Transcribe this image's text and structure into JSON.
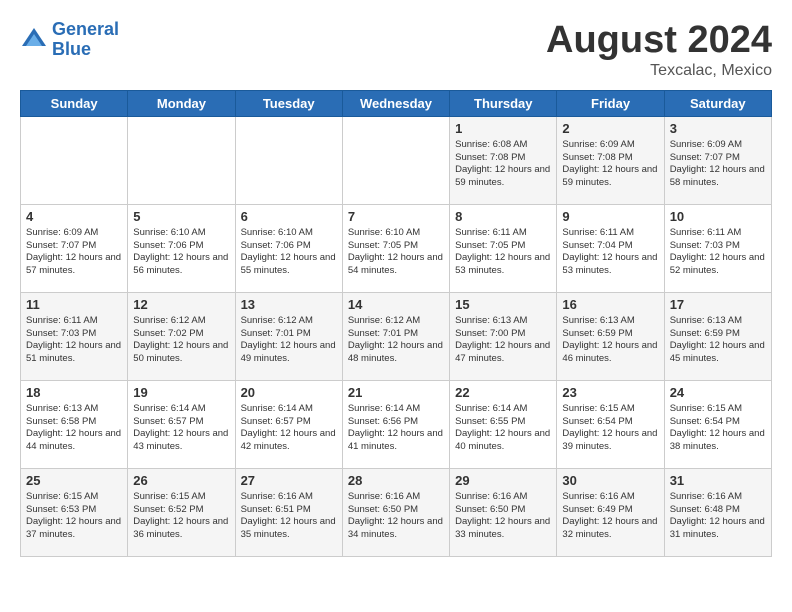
{
  "header": {
    "logo_line1": "General",
    "logo_line2": "Blue",
    "month_year": "August 2024",
    "location": "Texcalac, Mexico"
  },
  "weekdays": [
    "Sunday",
    "Monday",
    "Tuesday",
    "Wednesday",
    "Thursday",
    "Friday",
    "Saturday"
  ],
  "weeks": [
    [
      {
        "day": "",
        "sunrise": "",
        "sunset": "",
        "daylight": ""
      },
      {
        "day": "",
        "sunrise": "",
        "sunset": "",
        "daylight": ""
      },
      {
        "day": "",
        "sunrise": "",
        "sunset": "",
        "daylight": ""
      },
      {
        "day": "",
        "sunrise": "",
        "sunset": "",
        "daylight": ""
      },
      {
        "day": "1",
        "sunrise": "Sunrise: 6:08 AM",
        "sunset": "Sunset: 7:08 PM",
        "daylight": "Daylight: 12 hours and 59 minutes."
      },
      {
        "day": "2",
        "sunrise": "Sunrise: 6:09 AM",
        "sunset": "Sunset: 7:08 PM",
        "daylight": "Daylight: 12 hours and 59 minutes."
      },
      {
        "day": "3",
        "sunrise": "Sunrise: 6:09 AM",
        "sunset": "Sunset: 7:07 PM",
        "daylight": "Daylight: 12 hours and 58 minutes."
      }
    ],
    [
      {
        "day": "4",
        "sunrise": "Sunrise: 6:09 AM",
        "sunset": "Sunset: 7:07 PM",
        "daylight": "Daylight: 12 hours and 57 minutes."
      },
      {
        "day": "5",
        "sunrise": "Sunrise: 6:10 AM",
        "sunset": "Sunset: 7:06 PM",
        "daylight": "Daylight: 12 hours and 56 minutes."
      },
      {
        "day": "6",
        "sunrise": "Sunrise: 6:10 AM",
        "sunset": "Sunset: 7:06 PM",
        "daylight": "Daylight: 12 hours and 55 minutes."
      },
      {
        "day": "7",
        "sunrise": "Sunrise: 6:10 AM",
        "sunset": "Sunset: 7:05 PM",
        "daylight": "Daylight: 12 hours and 54 minutes."
      },
      {
        "day": "8",
        "sunrise": "Sunrise: 6:11 AM",
        "sunset": "Sunset: 7:05 PM",
        "daylight": "Daylight: 12 hours and 53 minutes."
      },
      {
        "day": "9",
        "sunrise": "Sunrise: 6:11 AM",
        "sunset": "Sunset: 7:04 PM",
        "daylight": "Daylight: 12 hours and 53 minutes."
      },
      {
        "day": "10",
        "sunrise": "Sunrise: 6:11 AM",
        "sunset": "Sunset: 7:03 PM",
        "daylight": "Daylight: 12 hours and 52 minutes."
      }
    ],
    [
      {
        "day": "11",
        "sunrise": "Sunrise: 6:11 AM",
        "sunset": "Sunset: 7:03 PM",
        "daylight": "Daylight: 12 hours and 51 minutes."
      },
      {
        "day": "12",
        "sunrise": "Sunrise: 6:12 AM",
        "sunset": "Sunset: 7:02 PM",
        "daylight": "Daylight: 12 hours and 50 minutes."
      },
      {
        "day": "13",
        "sunrise": "Sunrise: 6:12 AM",
        "sunset": "Sunset: 7:01 PM",
        "daylight": "Daylight: 12 hours and 49 minutes."
      },
      {
        "day": "14",
        "sunrise": "Sunrise: 6:12 AM",
        "sunset": "Sunset: 7:01 PM",
        "daylight": "Daylight: 12 hours and 48 minutes."
      },
      {
        "day": "15",
        "sunrise": "Sunrise: 6:13 AM",
        "sunset": "Sunset: 7:00 PM",
        "daylight": "Daylight: 12 hours and 47 minutes."
      },
      {
        "day": "16",
        "sunrise": "Sunrise: 6:13 AM",
        "sunset": "Sunset: 6:59 PM",
        "daylight": "Daylight: 12 hours and 46 minutes."
      },
      {
        "day": "17",
        "sunrise": "Sunrise: 6:13 AM",
        "sunset": "Sunset: 6:59 PM",
        "daylight": "Daylight: 12 hours and 45 minutes."
      }
    ],
    [
      {
        "day": "18",
        "sunrise": "Sunrise: 6:13 AM",
        "sunset": "Sunset: 6:58 PM",
        "daylight": "Daylight: 12 hours and 44 minutes."
      },
      {
        "day": "19",
        "sunrise": "Sunrise: 6:14 AM",
        "sunset": "Sunset: 6:57 PM",
        "daylight": "Daylight: 12 hours and 43 minutes."
      },
      {
        "day": "20",
        "sunrise": "Sunrise: 6:14 AM",
        "sunset": "Sunset: 6:57 PM",
        "daylight": "Daylight: 12 hours and 42 minutes."
      },
      {
        "day": "21",
        "sunrise": "Sunrise: 6:14 AM",
        "sunset": "Sunset: 6:56 PM",
        "daylight": "Daylight: 12 hours and 41 minutes."
      },
      {
        "day": "22",
        "sunrise": "Sunrise: 6:14 AM",
        "sunset": "Sunset: 6:55 PM",
        "daylight": "Daylight: 12 hours and 40 minutes."
      },
      {
        "day": "23",
        "sunrise": "Sunrise: 6:15 AM",
        "sunset": "Sunset: 6:54 PM",
        "daylight": "Daylight: 12 hours and 39 minutes."
      },
      {
        "day": "24",
        "sunrise": "Sunrise: 6:15 AM",
        "sunset": "Sunset: 6:54 PM",
        "daylight": "Daylight: 12 hours and 38 minutes."
      }
    ],
    [
      {
        "day": "25",
        "sunrise": "Sunrise: 6:15 AM",
        "sunset": "Sunset: 6:53 PM",
        "daylight": "Daylight: 12 hours and 37 minutes."
      },
      {
        "day": "26",
        "sunrise": "Sunrise: 6:15 AM",
        "sunset": "Sunset: 6:52 PM",
        "daylight": "Daylight: 12 hours and 36 minutes."
      },
      {
        "day": "27",
        "sunrise": "Sunrise: 6:16 AM",
        "sunset": "Sunset: 6:51 PM",
        "daylight": "Daylight: 12 hours and 35 minutes."
      },
      {
        "day": "28",
        "sunrise": "Sunrise: 6:16 AM",
        "sunset": "Sunset: 6:50 PM",
        "daylight": "Daylight: 12 hours and 34 minutes."
      },
      {
        "day": "29",
        "sunrise": "Sunrise: 6:16 AM",
        "sunset": "Sunset: 6:50 PM",
        "daylight": "Daylight: 12 hours and 33 minutes."
      },
      {
        "day": "30",
        "sunrise": "Sunrise: 6:16 AM",
        "sunset": "Sunset: 6:49 PM",
        "daylight": "Daylight: 12 hours and 32 minutes."
      },
      {
        "day": "31",
        "sunrise": "Sunrise: 6:16 AM",
        "sunset": "Sunset: 6:48 PM",
        "daylight": "Daylight: 12 hours and 31 minutes."
      }
    ]
  ]
}
